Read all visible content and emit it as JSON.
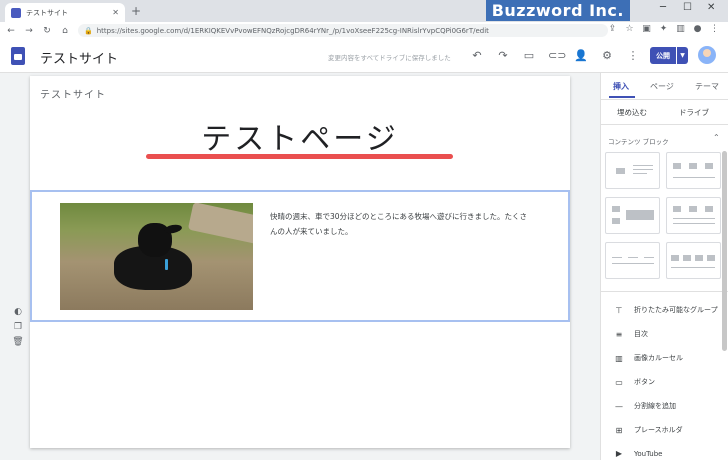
{
  "browser": {
    "tab_title": "テストサイト",
    "url": "https://sites.google.com/d/1ERKIQKEVvPvowEFNQzRojcgDR64rYNr_/p/1voXseeF225cg-INRislrYvpCQPi0G6rT/edit",
    "watermark": "Buzzword Inc."
  },
  "app": {
    "site_title": "テストサイト",
    "save_status": "変更内容をすべてドライブに保存しました",
    "publish_label": "公開"
  },
  "page": {
    "site_name": "テストサイト",
    "heading": "テストページ",
    "body_text": "快晴の週末、車で30分ほどのところにある牧場へ遊びに行きました。たくさんの人が来ていました。"
  },
  "panel": {
    "tabs": [
      "挿入",
      "ページ",
      "テーマ"
    ],
    "active_tab": "挿入",
    "insert_options": [
      "埋め込む",
      "ドライブ"
    ],
    "content_blocks_label": "コンテンツ ブロック",
    "items": [
      {
        "icon": "collapsible-group-icon",
        "label": "折りたたみ可能なグループ"
      },
      {
        "icon": "table-of-contents-icon",
        "label": "目次"
      },
      {
        "icon": "image-carousel-icon",
        "label": "画像カルーセル"
      },
      {
        "icon": "button-icon",
        "label": "ボタン"
      },
      {
        "icon": "divider-icon",
        "label": "分割線を追加"
      },
      {
        "icon": "placeholder-icon",
        "label": "プレースホルダ"
      },
      {
        "icon": "youtube-icon",
        "label": "YouTube"
      }
    ]
  },
  "colors": {
    "accent": "#3f51b5",
    "heading_underline": "#ea4f4f",
    "selection_border": "#a7c0f0"
  }
}
